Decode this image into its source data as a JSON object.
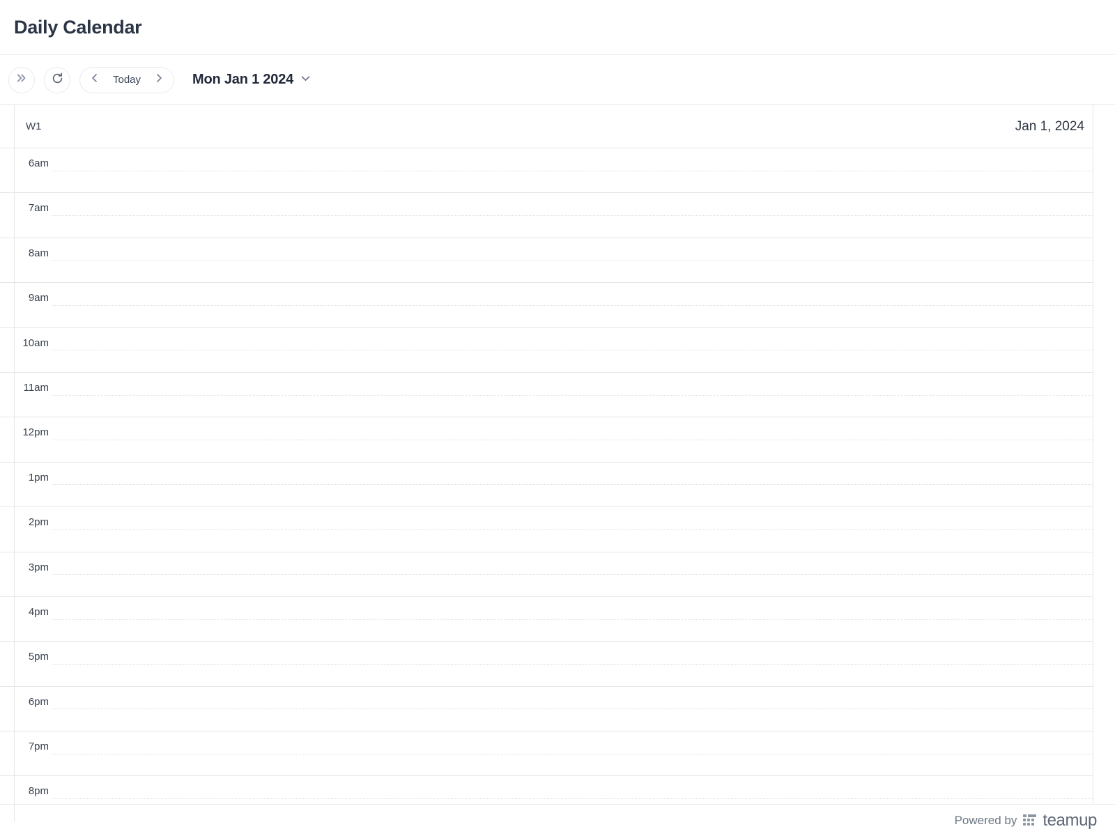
{
  "page": {
    "title": "Daily Calendar"
  },
  "toolbar": {
    "expand_icon": "double-chevron-right-icon",
    "refresh_icon": "refresh-icon",
    "prev_icon": "chevron-left-icon",
    "today_label": "Today",
    "next_icon": "chevron-right-icon",
    "current_date": "Mon Jan 1 2024",
    "date_dropdown_icon": "chevron-down-icon"
  },
  "calendar": {
    "week_number": "W1",
    "day_date": "Jan 1, 2024",
    "hours": [
      {
        "label": "6am"
      },
      {
        "label": "7am"
      },
      {
        "label": "8am"
      },
      {
        "label": "9am"
      },
      {
        "label": "10am"
      },
      {
        "label": "11am"
      },
      {
        "label": "12pm"
      },
      {
        "label": "1pm"
      },
      {
        "label": "2pm"
      },
      {
        "label": "3pm"
      },
      {
        "label": "4pm"
      },
      {
        "label": "5pm"
      },
      {
        "label": "6pm"
      },
      {
        "label": "7pm"
      },
      {
        "label": "8pm"
      }
    ],
    "events": []
  },
  "footer": {
    "powered_by": "Powered by",
    "brand": "teamup",
    "brand_mark_icon": "teamup-dots-logo-icon"
  },
  "colors": {
    "title_text": "#2b3545",
    "grid_line": "#e3e5e9",
    "dotted_line": "#dcdfe4",
    "control_border": "#e8eaee",
    "muted_text": "#6d7684"
  }
}
